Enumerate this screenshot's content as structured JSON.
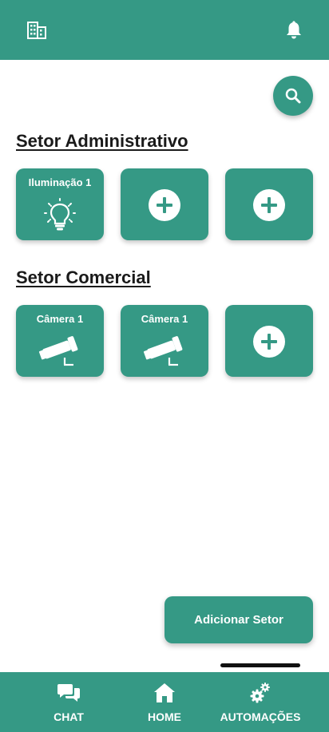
{
  "colors": {
    "primary": "#359985",
    "text_dark": "#1a1a1a",
    "white": "#ffffff"
  },
  "header": {
    "left_icon": "building-icon",
    "right_icon": "bell-icon"
  },
  "search": {
    "icon": "search-icon"
  },
  "sections": [
    {
      "title": "Setor Administrativo",
      "tiles": [
        {
          "label": "Iluminação 1",
          "icon": "lightbulb-icon"
        },
        {
          "label": "",
          "icon": "plus-circle-icon"
        },
        {
          "label": "",
          "icon": "plus-circle-icon"
        }
      ]
    },
    {
      "title": "Setor Comercial",
      "tiles": [
        {
          "label": "Câmera 1",
          "icon": "security-camera-icon"
        },
        {
          "label": "Câmera 1",
          "icon": "security-camera-icon"
        },
        {
          "label": "",
          "icon": "plus-circle-icon"
        }
      ]
    }
  ],
  "add_sector_button": {
    "label": "Adicionar Setor"
  },
  "bottom_nav": {
    "items": [
      {
        "label": "CHAT",
        "icon": "chat-icon"
      },
      {
        "label": "HOME",
        "icon": "home-icon"
      },
      {
        "label": "AUTOMAÇÕES",
        "icon": "gears-icon"
      }
    ]
  }
}
